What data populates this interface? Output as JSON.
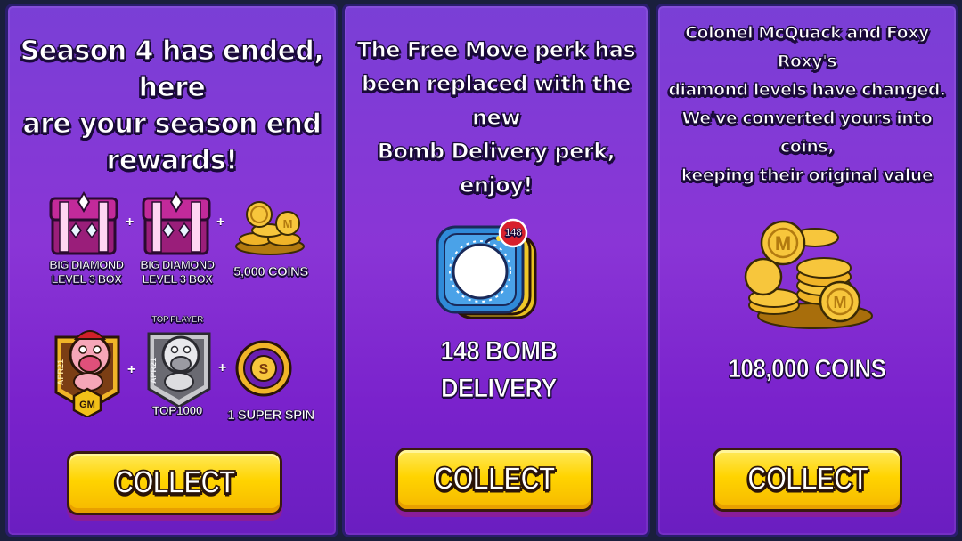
{
  "panels": [
    {
      "message": [
        "Season 4 has ended, here",
        "are your season end",
        "rewards!"
      ],
      "rewards": [
        {
          "icon": "big-diamond-box-icon",
          "label": [
            "BIG DIAMOND",
            "LEVEL 3 BOX"
          ]
        },
        {
          "icon": "big-diamond-box-icon",
          "label": [
            "BIG DIAMOND",
            "LEVEL 3 BOX"
          ]
        },
        {
          "icon": "coin-pile-icon",
          "label": [
            "5,000 COINS"
          ]
        },
        {
          "icon": "gm-badge-icon",
          "badge_side_text": "APR21",
          "badge_tag": "GM"
        },
        {
          "icon": "top-player-badge-icon",
          "top_text": "TOP PLAYER",
          "badge_side_text": "APR21",
          "bottom_text": "TOP1000"
        },
        {
          "icon": "super-spin-icon",
          "label": [
            "1 SUPER SPIN"
          ]
        }
      ],
      "plus": "+",
      "button_label": "COLLECT"
    },
    {
      "message": [
        "The Free Move perk has",
        "been replaced with the new",
        "Bomb Delivery perk, enjoy!"
      ],
      "perk_count_badge": "148",
      "reward_label": [
        "148 BOMB",
        "DELIVERY"
      ],
      "button_label": "COLLECT"
    },
    {
      "message": [
        "Colonel McQuack and Foxy Roxy's",
        "diamond levels have changed.",
        "We've converted yours into coins,",
        "keeping their original value"
      ],
      "reward_label": "108,000 COINS",
      "button_label": "COLLECT"
    }
  ],
  "colors": {
    "panel_purple": "#8a35d6",
    "button_yellow": "#ffd400",
    "coin_gold": "#f0b428",
    "perk_blue": "#2f8ad8"
  }
}
